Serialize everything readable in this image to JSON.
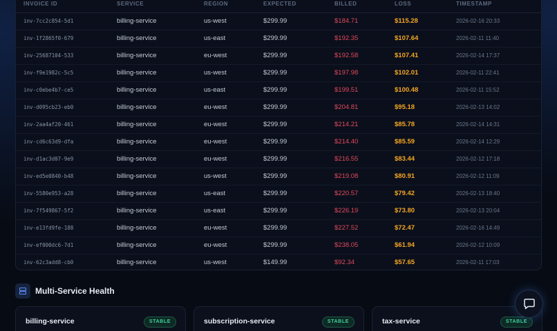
{
  "table": {
    "headers": {
      "invoice_id": "INVOICE ID",
      "service": "SERVICE",
      "region": "REGION",
      "expected": "EXPECTED",
      "billed": "BILLED",
      "loss": "LOSS",
      "timestamp": "TIMESTAMP"
    },
    "rows": [
      {
        "id": "inv-7cc2c854-5d1",
        "service": "billing-service",
        "region": "us-west",
        "expected": "$299.99",
        "billed": "$184.71",
        "loss": "$115.28",
        "ts": "2026-02-16 20:33"
      },
      {
        "id": "inv-1f2865f0-679",
        "service": "billing-service",
        "region": "us-east",
        "expected": "$299.99",
        "billed": "$192.35",
        "loss": "$107.64",
        "ts": "2026-02-11 11:40"
      },
      {
        "id": "inv-25687104-533",
        "service": "billing-service",
        "region": "eu-west",
        "expected": "$299.99",
        "billed": "$192.58",
        "loss": "$107.41",
        "ts": "2026-02-14 17:37"
      },
      {
        "id": "inv-f9e1982c-5c5",
        "service": "billing-service",
        "region": "us-west",
        "expected": "$299.99",
        "billed": "$197.98",
        "loss": "$102.01",
        "ts": "2026-02-11 22:41"
      },
      {
        "id": "inv-c0ebe4b7-ce5",
        "service": "billing-service",
        "region": "us-east",
        "expected": "$299.99",
        "billed": "$199.51",
        "loss": "$100.48",
        "ts": "2026-02-11 15:52"
      },
      {
        "id": "inv-d095cb23-eb0",
        "service": "billing-service",
        "region": "eu-west",
        "expected": "$299.99",
        "billed": "$204.81",
        "loss": "$95.18",
        "ts": "2026-02-13 14:02"
      },
      {
        "id": "inv-2aa4af20-461",
        "service": "billing-service",
        "region": "eu-west",
        "expected": "$299.99",
        "billed": "$214.21",
        "loss": "$85.78",
        "ts": "2026-02-14 14:31"
      },
      {
        "id": "inv-cd6c63d9-dfa",
        "service": "billing-service",
        "region": "eu-west",
        "expected": "$299.99",
        "billed": "$214.40",
        "loss": "$85.59",
        "ts": "2026-02-14 12:29"
      },
      {
        "id": "inv-d1ac3d07-9e9",
        "service": "billing-service",
        "region": "eu-west",
        "expected": "$299.99",
        "billed": "$216.55",
        "loss": "$83.44",
        "ts": "2026-02-12 17:18"
      },
      {
        "id": "inv-ed5e0840-b48",
        "service": "billing-service",
        "region": "us-west",
        "expected": "$299.99",
        "billed": "$219.08",
        "loss": "$80.91",
        "ts": "2026-02-12 11:09"
      },
      {
        "id": "inv-5580e953-a28",
        "service": "billing-service",
        "region": "us-east",
        "expected": "$299.99",
        "billed": "$220.57",
        "loss": "$79.42",
        "ts": "2026-02-13 18:40"
      },
      {
        "id": "inv-7f549867-5f2",
        "service": "billing-service",
        "region": "us-east",
        "expected": "$299.99",
        "billed": "$226.19",
        "loss": "$73.80",
        "ts": "2026-02-13 20:04"
      },
      {
        "id": "inv-e13fd9fe-188",
        "service": "billing-service",
        "region": "eu-west",
        "expected": "$299.99",
        "billed": "$227.52",
        "loss": "$72.47",
        "ts": "2026-02-16 14:49"
      },
      {
        "id": "inv-ef000dc6-7d1",
        "service": "billing-service",
        "region": "eu-west",
        "expected": "$299.99",
        "billed": "$238.05",
        "loss": "$61.94",
        "ts": "2026-02-12 10:09"
      },
      {
        "id": "inv-62c3add8-cb0",
        "service": "billing-service",
        "region": "us-west",
        "expected": "$149.99",
        "billed": "$92.34",
        "loss": "$57.65",
        "ts": "2026-02-11 17:03"
      }
    ]
  },
  "health": {
    "title": "Multi-Service Health",
    "icon": "server-stack-icon",
    "cards": [
      {
        "name": "billing-service",
        "status": "STABLE"
      },
      {
        "name": "subscription-service",
        "status": "STABLE"
      },
      {
        "name": "tax-service",
        "status": "STABLE"
      }
    ]
  },
  "chat": {
    "icon": "chat-bubble-icon"
  },
  "colors": {
    "billed": "#e2485d",
    "loss": "#f5a623",
    "stable": "#3fd4a0",
    "background": "#070b14"
  }
}
